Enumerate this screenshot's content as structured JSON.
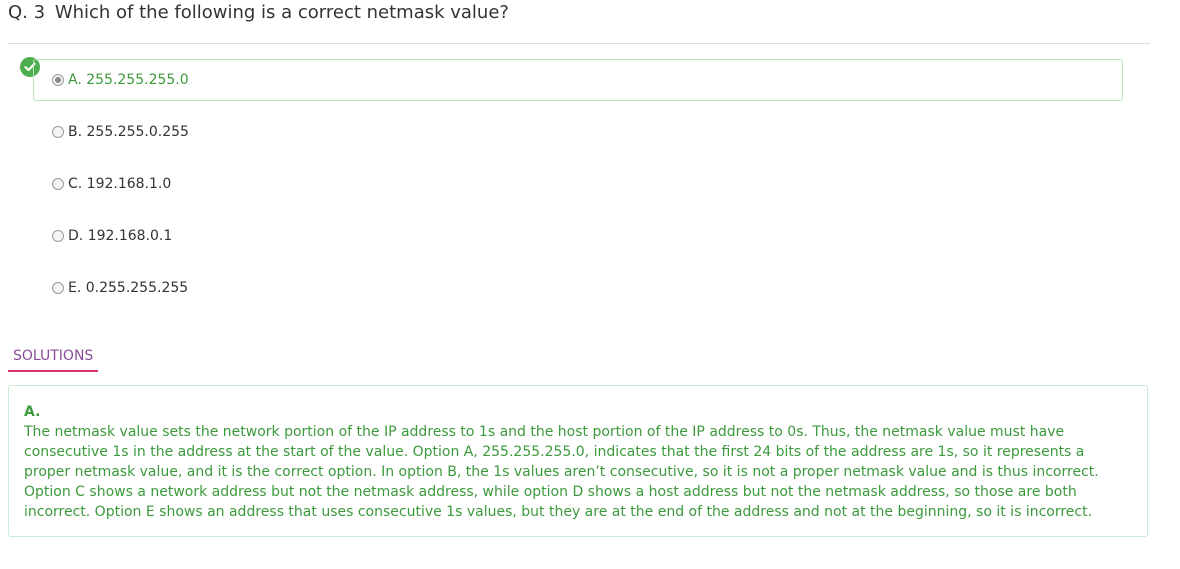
{
  "question": {
    "number": "Q. 3",
    "text": "Which of the following is a correct netmask value?"
  },
  "options": [
    {
      "label": "A. 255.255.255.0",
      "selected": true,
      "correct": true
    },
    {
      "label": "B. 255.255.0.255",
      "selected": false,
      "correct": false
    },
    {
      "label": "C. 192.168.1.0",
      "selected": false,
      "correct": false
    },
    {
      "label": "D. 192.168.0.1",
      "selected": false,
      "correct": false
    },
    {
      "label": "E. 0.255.255.255",
      "selected": false,
      "correct": false
    }
  ],
  "solutions": {
    "tab_label": "SOLUTIONS",
    "answer": "A.",
    "explanation": "The netmask value sets the network portion of the IP address to 1s and the host portion of the IP address to 0s. Thus, the netmask value must have consecutive 1s in the address at the start of the value. Option A, 255.255.255.0, indicates that the first 24 bits of the address are 1s, so it represents a proper netmask value, and it is the correct option. In option B, the 1s values aren’t consecutive, so it is not a proper netmask value and is thus incorrect. Option C shows a network address but not the netmask address, while option D shows a host address but not the netmask address, so those are both incorrect. Option E shows an address that uses consecutive 1s values, but they are at the end of the address and not at the beginning, so it is incorrect."
  },
  "colors": {
    "correct_green": "#4cae4c",
    "solution_text": "#3c9a3c",
    "tab_text": "#8a4c9a",
    "tab_underline": "#d6336c"
  },
  "icons": {
    "correct_indicator": "check-circle-icon"
  }
}
